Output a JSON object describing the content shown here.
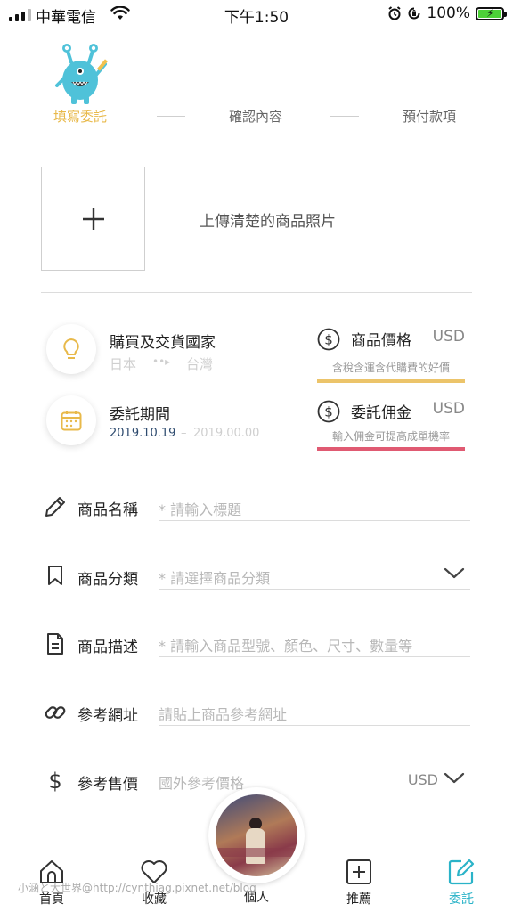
{
  "status_bar": {
    "carrier": "中華電信",
    "time": "下午1:50",
    "battery_pct": "100%"
  },
  "steps": {
    "step1": "填寫委託",
    "step2": "確認內容",
    "step3": "預付款項"
  },
  "upload": {
    "plus": "+",
    "label": "上傳清楚的商品照片"
  },
  "location": {
    "title": "購買及交貨國家",
    "from": "日本",
    "arrow": "••▸",
    "to": "台灣"
  },
  "period": {
    "title": "委託期間",
    "start": "2019.10.19",
    "dash": "–",
    "end": "2019.00.00"
  },
  "price": {
    "title": "商品價格",
    "currency": "USD",
    "hint": "含稅含運含代購費的好價",
    "accent": "#ecc46a"
  },
  "commission": {
    "title": "委託佣金",
    "currency": "USD",
    "hint": "輸入佣金可提高成單機率",
    "accent": "#e05a72"
  },
  "fields": [
    {
      "label": "商品名稱",
      "placeholder": "* 請輸入標題",
      "icon": "pencil-icon"
    },
    {
      "label": "商品分類",
      "placeholder": "* 請選擇商品分類",
      "icon": "bookmark-icon"
    },
    {
      "label": "商品描述",
      "placeholder": "* 請輸入商品型號、顏色、尺寸、數量等",
      "icon": "document-icon"
    },
    {
      "label": "參考網址",
      "placeholder": "請貼上商品參考網址",
      "icon": "link-icon"
    },
    {
      "label": "參考售價",
      "placeholder": "國外參考價格",
      "currency": "USD",
      "icon": "dollar-icon"
    }
  ],
  "tabs": [
    {
      "label": "首頁",
      "icon": "home-icon"
    },
    {
      "label": "收藏",
      "icon": "heart-icon"
    },
    {
      "label": "個人",
      "icon": "avatar"
    },
    {
      "label": "推薦",
      "icon": "plus-square-icon"
    },
    {
      "label": "委託",
      "icon": "edit-icon",
      "active": true
    }
  ],
  "accent_color": "#2ab3c8",
  "step_active_color": "#e8b94a",
  "watermark": "小涵と大世界@http://cynthiag.pixnet.net/blog"
}
